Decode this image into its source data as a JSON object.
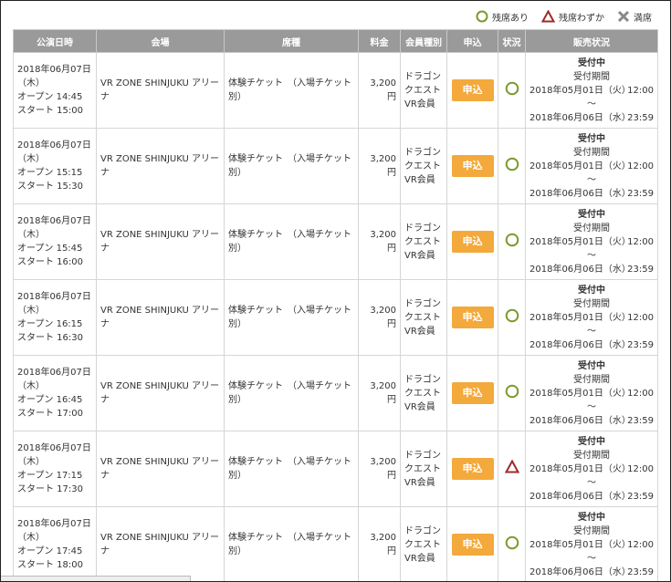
{
  "legend": [
    {
      "icon": "circle-available-icon",
      "label": "残席あり"
    },
    {
      "icon": "triangle-few-icon",
      "label": "残席わずか"
    },
    {
      "icon": "cross-full-icon",
      "label": "満席"
    }
  ],
  "colors": {
    "header_bg": "#9a9a9a",
    "button_bg": "#f3a93b",
    "circle": "#7a9a2e",
    "triangle": "#9e2b2b",
    "cross": "#888888"
  },
  "table": {
    "headers": [
      "公演日時",
      "会場",
      "席種",
      "料金",
      "会員種別",
      "申込",
      "状況",
      "販売状況"
    ],
    "rows": [
      {
        "date": "2018年06月07日",
        "weekday": "（木）",
        "open": "オープン 14:45",
        "start": "スタート 15:00",
        "venue": "VR ZONE SHINJUKU アリーナ",
        "seat": "体験チケット　（入場チケット別）",
        "price": "3,200円",
        "member1": "ドラゴン",
        "member2": "クエスト",
        "member3": "VR会員",
        "button": "申込",
        "status": "circle",
        "sales_status": "受付中",
        "sales_period_label": "受付期間",
        "sales_from_date": "2018年05月01日（火）",
        "sales_from_time": "12:00",
        "sales_tilde": "～",
        "sales_to_date": "2018年06月06日（水）",
        "sales_to_time": "23:59"
      },
      {
        "date": "2018年06月07日",
        "weekday": "（木）",
        "open": "オープン 15:15",
        "start": "スタート 15:30",
        "venue": "VR ZONE SHINJUKU アリーナ",
        "seat": "体験チケット　（入場チケット別）",
        "price": "3,200円",
        "member1": "ドラゴン",
        "member2": "クエスト",
        "member3": "VR会員",
        "button": "申込",
        "status": "circle",
        "sales_status": "受付中",
        "sales_period_label": "受付期間",
        "sales_from_date": "2018年05月01日（火）",
        "sales_from_time": "12:00",
        "sales_tilde": "～",
        "sales_to_date": "2018年06月06日（水）",
        "sales_to_time": "23:59"
      },
      {
        "date": "2018年06月07日",
        "weekday": "（木）",
        "open": "オープン 15:45",
        "start": "スタート 16:00",
        "venue": "VR ZONE SHINJUKU アリーナ",
        "seat": "体験チケット　（入場チケット別）",
        "price": "3,200円",
        "member1": "ドラゴン",
        "member2": "クエスト",
        "member3": "VR会員",
        "button": "申込",
        "status": "circle",
        "sales_status": "受付中",
        "sales_period_label": "受付期間",
        "sales_from_date": "2018年05月01日（火）",
        "sales_from_time": "12:00",
        "sales_tilde": "～",
        "sales_to_date": "2018年06月06日（水）",
        "sales_to_time": "23:59"
      },
      {
        "date": "2018年06月07日",
        "weekday": "（木）",
        "open": "オープン 16:15",
        "start": "スタート 16:30",
        "venue": "VR ZONE SHINJUKU アリーナ",
        "seat": "体験チケット　（入場チケット別）",
        "price": "3,200円",
        "member1": "ドラゴン",
        "member2": "クエスト",
        "member3": "VR会員",
        "button": "申込",
        "status": "circle",
        "sales_status": "受付中",
        "sales_period_label": "受付期間",
        "sales_from_date": "2018年05月01日（火）",
        "sales_from_time": "12:00",
        "sales_tilde": "～",
        "sales_to_date": "2018年06月06日（水）",
        "sales_to_time": "23:59"
      },
      {
        "date": "2018年06月07日",
        "weekday": "（木）",
        "open": "オープン 16:45",
        "start": "スタート 17:00",
        "venue": "VR ZONE SHINJUKU アリーナ",
        "seat": "体験チケット　（入場チケット別）",
        "price": "3,200円",
        "member1": "ドラゴン",
        "member2": "クエスト",
        "member3": "VR会員",
        "button": "申込",
        "status": "circle",
        "sales_status": "受付中",
        "sales_period_label": "受付期間",
        "sales_from_date": "2018年05月01日（火）",
        "sales_from_time": "12:00",
        "sales_tilde": "～",
        "sales_to_date": "2018年06月06日（水）",
        "sales_to_time": "23:59"
      },
      {
        "date": "2018年06月07日",
        "weekday": "（木）",
        "open": "オープン 17:15",
        "start": "スタート 17:30",
        "venue": "VR ZONE SHINJUKU アリーナ",
        "seat": "体験チケット　（入場チケット別）",
        "price": "3,200円",
        "member1": "ドラゴン",
        "member2": "クエスト",
        "member3": "VR会員",
        "button": "申込",
        "status": "triangle",
        "sales_status": "受付中",
        "sales_period_label": "受付期間",
        "sales_from_date": "2018年05月01日（火）",
        "sales_from_time": "12:00",
        "sales_tilde": "～",
        "sales_to_date": "2018年06月06日（水）",
        "sales_to_time": "23:59"
      },
      {
        "date": "2018年06月07日",
        "weekday": "（木）",
        "open": "オープン 17:45",
        "start": "スタート 18:00",
        "venue": "VR ZONE SHINJUKU アリーナ",
        "seat": "体験チケット　（入場チケット別）",
        "price": "3,200円",
        "member1": "ドラゴン",
        "member2": "クエスト",
        "member3": "VR会員",
        "button": "申込",
        "status": "circle",
        "sales_status": "受付中",
        "sales_period_label": "受付期間",
        "sales_from_date": "2018年05月01日（火）",
        "sales_from_time": "12:00",
        "sales_tilde": "～",
        "sales_to_date": "2018年06月06日（水）",
        "sales_to_time": "23:59"
      }
    ]
  }
}
